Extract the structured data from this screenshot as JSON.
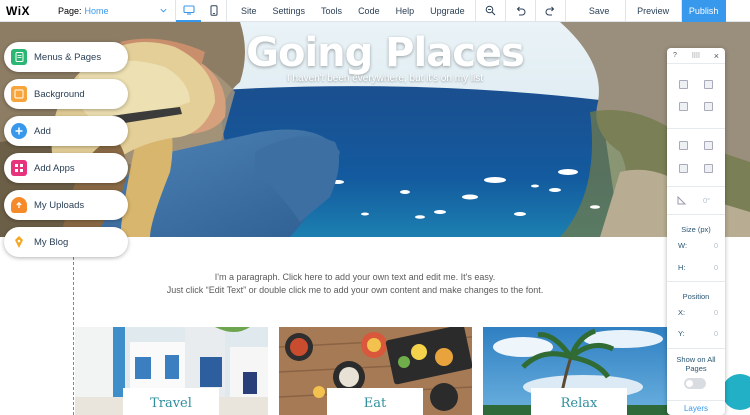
{
  "topbar": {
    "logo": "WiX",
    "page_label": "Page:",
    "page_value": "Home",
    "menu": [
      "Site",
      "Settings",
      "Tools",
      "Code",
      "Help",
      "Upgrade"
    ],
    "save": "Save",
    "preview": "Preview",
    "publish": "Publish"
  },
  "hero": {
    "title": "Going Places",
    "subtitle": "I haven't been everywhere, but it's on my list"
  },
  "left_panel": {
    "items": [
      {
        "label": "Menus & Pages",
        "icon": "pages-icon",
        "color": "#2bb673"
      },
      {
        "label": "Background",
        "icon": "background-icon",
        "color": "#f7a43a"
      },
      {
        "label": "Add",
        "icon": "add-icon",
        "color": "#3899ec"
      },
      {
        "label": "Add Apps",
        "icon": "apps-icon",
        "color": "#e6337c"
      },
      {
        "label": "My Uploads",
        "icon": "upload-icon",
        "color": "#f58a2a"
      },
      {
        "label": "My Blog",
        "icon": "blog-icon",
        "color": "#f5a623"
      }
    ]
  },
  "content": {
    "paragraph_line1": "I'm a paragraph. Click here to add your own text and edit me. It's easy.",
    "paragraph_line2": "Just click “Edit Text” or double click me to add your own content and make changes to the font."
  },
  "cards": [
    "Travel",
    "Eat",
    "Relax"
  ],
  "right_panel": {
    "help": "?",
    "close": "×",
    "rotation": "0°",
    "size_title": "Size (px)",
    "w_label": "W:",
    "w_value": "0",
    "h_label": "H:",
    "h_value": "0",
    "position_title": "Position",
    "x_label": "X:",
    "x_value": "0",
    "y_label": "Y:",
    "y_value": "0",
    "show_all_pages": "Show on All Pages",
    "layers": "Layers"
  },
  "colors": {
    "accent": "#3899ec",
    "card_text": "#2f8f9d"
  }
}
